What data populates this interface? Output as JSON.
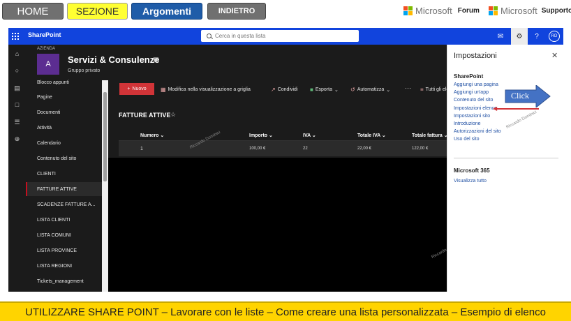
{
  "topnav": {
    "home": "HOME",
    "sezione": "SEZIONE",
    "argomenti": "Argomenti",
    "indietro": "INDIETRO",
    "ms_forum_word": "Microsoft",
    "ms_forum_label": "Forum",
    "ms_support_word": "Microsoft",
    "ms_support_label": "Supporto"
  },
  "sharepoint": {
    "app_name": "SharePoint",
    "search_placeholder": "Cerca in questa lista",
    "avatar": "RD"
  },
  "site": {
    "org": "AZIENDA",
    "logo_letter": "A",
    "name": "Servizi & Consulenze",
    "subtitle": "Gruppo privato"
  },
  "leftnav": {
    "items": [
      "Blocco appunti",
      "Pagine",
      "Documenti",
      "Attività",
      "Calendario",
      "Contenuto del sito",
      "CLIENTI",
      "FATTURE ATTIVE",
      "SCADENZE FATTURE A...",
      "LISTA CLIENTI",
      "LISTA COMUNI",
      "LISTA PROVINCE",
      "LISTA REGIONI",
      "Tickets_management"
    ]
  },
  "commandbar": {
    "new": "Nuovo",
    "grid_edit": "Modifica nella visualizzazione a griglia",
    "share": "Condividi",
    "export": "Esporta",
    "automate": "Automatizza",
    "more": "···",
    "all_items": "Tutti gli ele"
  },
  "list": {
    "title": "FATTURE ATTIVE",
    "columns": [
      "Numero",
      "Importo",
      "IVA",
      "Totale IVA",
      "Totale fattura"
    ],
    "rows": [
      {
        "numero": "1",
        "importo": "100,00 €",
        "iva": "22",
        "totale_iva": "22,00 €",
        "totale_fattura": "122,00 €"
      }
    ]
  },
  "watermark": "Riccardo Dominici",
  "settings_panel": {
    "title": "Impostazioni",
    "sharepoint_section": "SharePoint",
    "sharepoint_links": [
      "Aggiungi una pagina",
      "Aggiungi un'app",
      "Contenuto del sito",
      "Impostazioni elenco",
      "Impostazioni sito",
      "Introduzione",
      "Autorizzazioni del sito",
      "Uso del sito"
    ],
    "m365_section": "Microsoft 365",
    "m365_link": "Visualizza tutto"
  },
  "annotation": {
    "click": "Click"
  },
  "caption": "UTILIZZARE SHARE POINT – Lavorare con le liste – Come creare una lista personalizzata – Esempio di elenco",
  "colors": {
    "header_blue": "#1144dd",
    "accent_red": "#d13438",
    "caption_yellow": "#ffd400",
    "argomenti_blue": "#1f5ca8"
  }
}
